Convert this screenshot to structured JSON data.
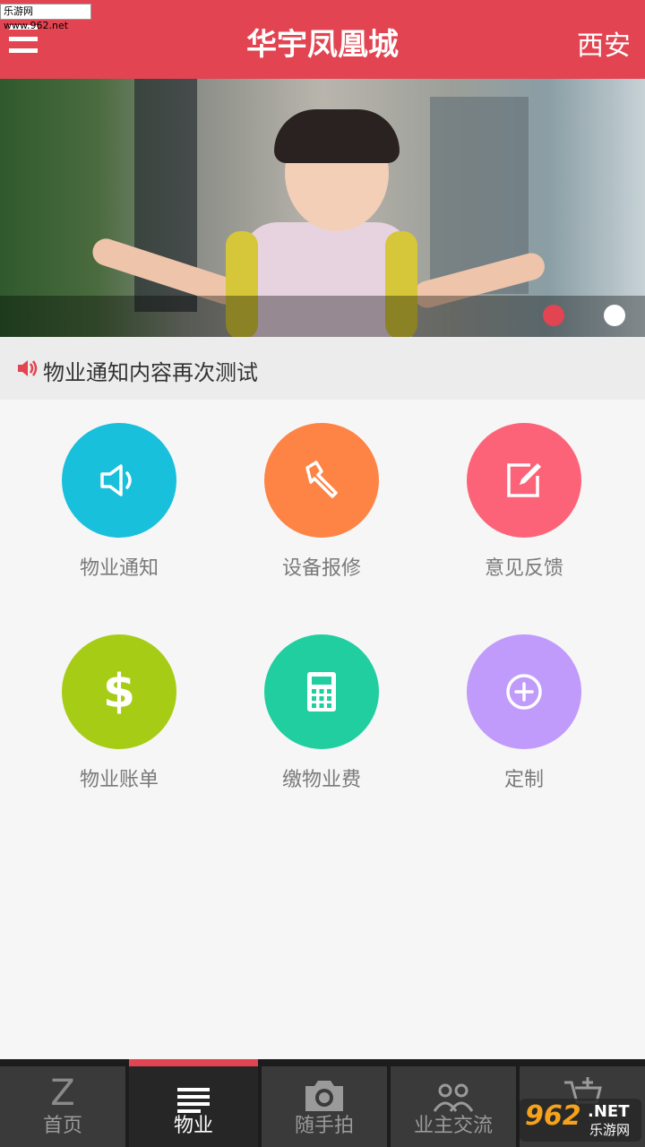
{
  "watermark": {
    "top_text": "乐游网 www.962.net",
    "bottom_big": "962",
    "bottom_net": ".NET",
    "bottom_cn": "乐游网"
  },
  "header": {
    "title": "华宇凤凰城",
    "city": "西安",
    "bg_color": "#e24451"
  },
  "banner": {
    "slides": 2,
    "active_slide": 1
  },
  "notice": {
    "text": "物业通知内容再次测试"
  },
  "grid": {
    "items": [
      {
        "label": "物业通知",
        "icon": "speaker-icon",
        "color": "#19c0db"
      },
      {
        "label": "设备报修",
        "icon": "wrench-icon",
        "color": "#fd8445"
      },
      {
        "label": "意见反馈",
        "icon": "edit-icon",
        "color": "#fd6378"
      },
      {
        "label": "物业账单",
        "icon": "dollar-icon",
        "color": "#a7cc16"
      },
      {
        "label": "缴物业费",
        "icon": "calculator-icon",
        "color": "#21cea0"
      },
      {
        "label": "定制",
        "icon": "plus-circle-icon",
        "color": "#c09bfb"
      }
    ]
  },
  "tabbar": {
    "tabs": [
      {
        "label": "首页",
        "icon": "home-z-icon"
      },
      {
        "label": "物业",
        "icon": "list-icon",
        "active": true
      },
      {
        "label": "随手拍",
        "icon": "camera-icon"
      },
      {
        "label": "业主交流",
        "icon": "people-icon"
      },
      {
        "label": "",
        "icon": "cart-add-icon"
      }
    ]
  }
}
